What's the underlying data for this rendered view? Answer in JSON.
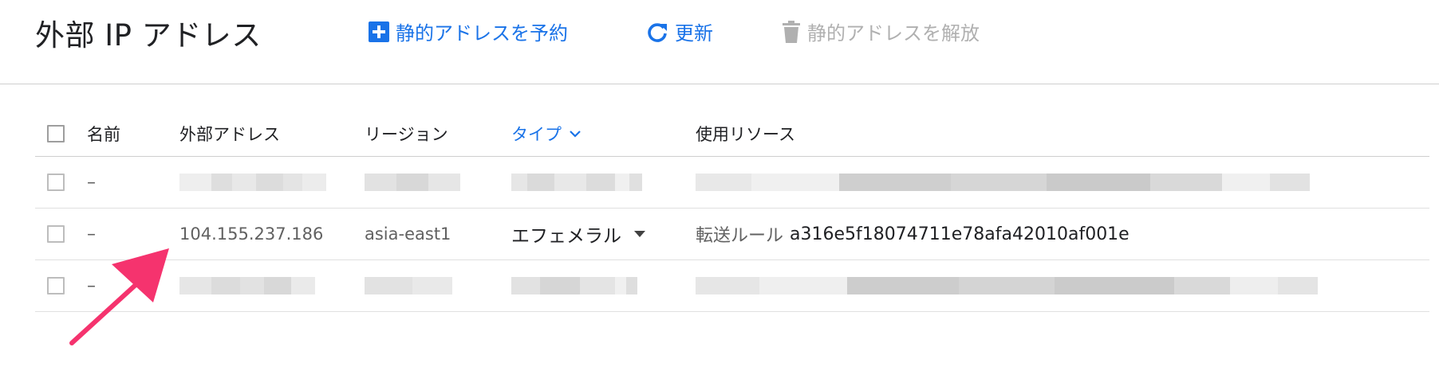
{
  "header": {
    "title": "外部 IP アドレス",
    "actions": {
      "reserve_label": "静的アドレスを予約",
      "refresh_label": "更新",
      "release_label": "静的アドレスを解放"
    }
  },
  "table": {
    "columns": {
      "name": "名前",
      "address": "外部アドレス",
      "region": "リージョン",
      "type": "タイプ",
      "in_use_by": "使用リソース"
    },
    "rows": [
      {
        "name": "–",
        "address": "",
        "region": "",
        "type": "",
        "in_use_label": "",
        "in_use_value": "",
        "redacted": true
      },
      {
        "name": "–",
        "address": "104.155.237.186",
        "region": "asia-east1",
        "type": "エフェメラル",
        "in_use_label": "転送ルール",
        "in_use_value": "a316e5f18074711e78afa42010af001e",
        "redacted": false
      },
      {
        "name": "–",
        "address": "",
        "region": "",
        "type": "",
        "in_use_label": "",
        "in_use_value": "",
        "redacted": true
      }
    ]
  },
  "colors": {
    "accent": "#1a73e8",
    "annotation_arrow": "#f5336e",
    "disabled": "#b0b0b0"
  },
  "icons": {
    "reserve": "add-box-icon",
    "refresh": "refresh-icon",
    "release": "trash-icon",
    "sort": "chevron-down-icon",
    "dropdown": "dropdown-triangle-icon"
  }
}
